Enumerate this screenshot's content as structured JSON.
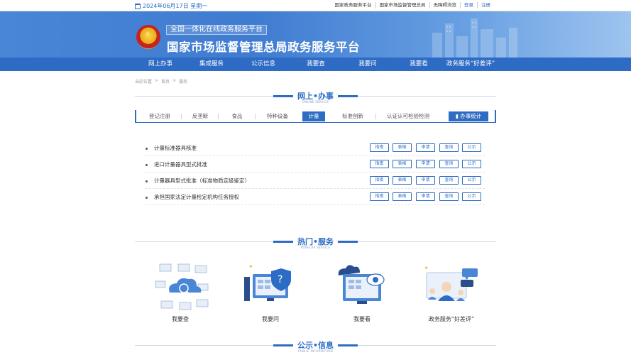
{
  "topbar": {
    "date": "2024年06月17日 星期一",
    "links": [
      "国家政务服务平台",
      "国家市场监督管理总局",
      "无障碍浏览",
      "登录",
      "注册"
    ]
  },
  "banner": {
    "subtitle": "全国一体化在线政务服务平台",
    "title": "国家市场监督管理总局政务服务平台"
  },
  "nav": {
    "items": [
      "网上办事",
      "集成服务",
      "公示信息",
      "我要查",
      "我要问",
      "我要看",
      "政务服务“好差评”"
    ]
  },
  "breadcrumb": {
    "home": "当前位置",
    "sep": ">",
    "level1": "首页",
    "level2": "服务"
  },
  "online": {
    "title": "网上•办事",
    "subtitle": "ONLINE SERVICE",
    "tabs": [
      "登记注册",
      "反垄断",
      "食品",
      "特种设备",
      "计量",
      "标准创新",
      "认证认可检验检测"
    ],
    "stats_label": "办事统计",
    "items": [
      "计量标准器具核准",
      "进口计量器具型式批准",
      "计量器具型式批准（标准物质定级鉴定）",
      "承担国家法定计量检定机构任务授权"
    ],
    "buttons": [
      "指南",
      "表格",
      "申请",
      "查询",
      "公示"
    ]
  },
  "popular": {
    "title": "热门•服务",
    "subtitle": "POPULAR SERVICE",
    "services": [
      "我要查",
      "我要问",
      "我要看",
      "政务服务“好差评”"
    ]
  },
  "public": {
    "title": "公示•信息",
    "subtitle": "PUBLIC INFORMATION"
  },
  "colors": {
    "primary": "#2d6cc4",
    "banner": "#4a86d6"
  }
}
